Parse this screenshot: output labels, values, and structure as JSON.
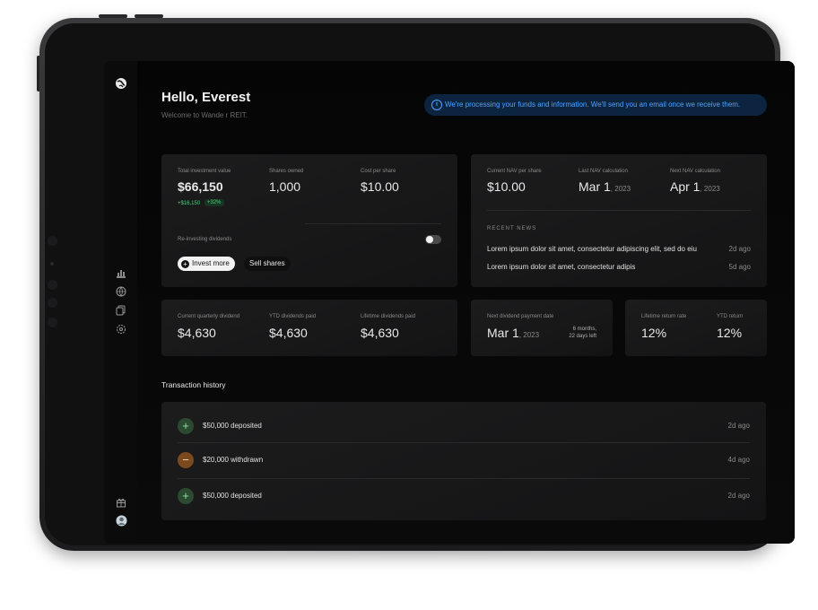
{
  "colors": {
    "accent_blue": "#4ea3ff",
    "banner_bg": "#0c2440",
    "positive_green": "#4cd07a",
    "deposit_icon_bg": "#2c4a30",
    "withdraw_icon_bg": "#7a4a1e"
  },
  "sidebar": {
    "icons": [
      "globe-icon",
      "chart-icon",
      "network-icon",
      "copy-icon",
      "settings-icon",
      "gift-icon",
      "avatar"
    ]
  },
  "header": {
    "greeting": "Hello, Everest",
    "welcome": "Welcome to Wande r REIT.",
    "banner_icon": "info-icon",
    "banner_icon_glyph": "i",
    "banner_text": "We're processing your funds and information. We'll send you an email once we receive them."
  },
  "investment": {
    "total_label": "Total investment value",
    "total_value": "$66,150",
    "change_amount": "+$16,150",
    "change_percent": "+32%",
    "shares_label": "Shares owned",
    "shares_value": "1,000",
    "cost_label": "Cost per share",
    "cost_value": "$10.00",
    "reinvest_label": "Re-investing dividends",
    "reinvest_on": false,
    "invest_more_label": "Invest more",
    "sell_shares_label": "Sell shares"
  },
  "nav": {
    "current_label": "Current NAV per share",
    "current_value": "$10.00",
    "last_label": "Last NAV calculation",
    "last_date": "Mar 1",
    "last_year": ", 2023",
    "next_label": "Next NAV calculation",
    "next_date": "Apr 1",
    "next_year": ", 2023",
    "news_title": "RECENT NEWS",
    "news": [
      {
        "text": "Lorem ipsum dolor sit amet, consectetur adipiscing elit, sed do eiu",
        "time": "2d ago"
      },
      {
        "text": "Lorem ipsum dolor sit amet, consectetur adipis",
        "time": "5d ago"
      }
    ]
  },
  "dividends": {
    "quarterly_label": "Current quarterly dividend",
    "quarterly_value": "$4,630",
    "ytd_label": "YTD dividends paid",
    "ytd_value": "$4,630",
    "lifetime_label": "Lifetime dividends paid",
    "lifetime_value": "$4,630"
  },
  "payment": {
    "label": "Next dividend payment date",
    "date": "Mar 1",
    "year": ", 2023",
    "countdown_line1": "6 months,",
    "countdown_line2": "22 days left"
  },
  "returns": {
    "lifetime_label": "Lifetime return rate",
    "lifetime_value": "12%",
    "ytd_label": "YTD return",
    "ytd_value": "12%"
  },
  "transactions": {
    "title": "Transaction history",
    "rows": [
      {
        "icon": "plus-icon",
        "glyph": "+",
        "text": "$50,000 deposited",
        "time": "2d ago"
      },
      {
        "icon": "minus-icon",
        "glyph": "−",
        "text": "$20,000 withdrawn",
        "time": "4d ago"
      },
      {
        "icon": "plus-icon",
        "glyph": "+",
        "text": "$50,000 deposited",
        "time": "2d ago"
      }
    ]
  }
}
